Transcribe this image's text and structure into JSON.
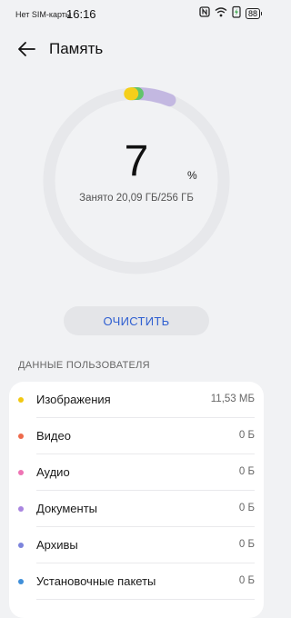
{
  "status_bar": {
    "carrier": "Нет SIM-карты",
    "time": "16:16",
    "battery": "88",
    "icons": [
      "nfc-icon",
      "wifi-icon",
      "charging-icon",
      "battery-icon"
    ]
  },
  "header": {
    "title": "Память",
    "back_icon": "arrow-left-icon"
  },
  "storage": {
    "percent": "7",
    "percent_sign": "%",
    "used_text": "Занято 20,09 ГБ/256 ГБ",
    "used_fraction": 0.07,
    "ring_color": "#e7e8eb",
    "segment_colors": [
      "#f5cf1b",
      "#62c46b",
      "#b7a8de"
    ]
  },
  "actions": {
    "clean_label": "ОЧИСТИТЬ",
    "accent": "#2f5fd1"
  },
  "user_data": {
    "section_title": "ДАННЫЕ ПОЛЬЗОВАТЕЛЯ",
    "items": [
      {
        "label": "Изображения",
        "size": "11,53 МБ",
        "color": "#f2c811"
      },
      {
        "label": "Видео",
        "size": "0 Б",
        "color": "#ee6a4c"
      },
      {
        "label": "Аудио",
        "size": "0 Б",
        "color": "#ee74b4"
      },
      {
        "label": "Документы",
        "size": "0 Б",
        "color": "#a985e0"
      },
      {
        "label": "Архивы",
        "size": "0 Б",
        "color": "#7c84dc"
      },
      {
        "label": "Установочные пакеты",
        "size": "0 Б",
        "color": "#3f8fd9"
      }
    ]
  }
}
